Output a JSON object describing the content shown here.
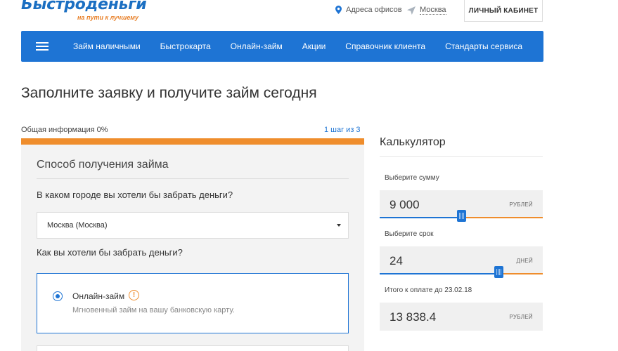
{
  "header": {
    "logo_text": "Быстроденьги",
    "logo_tagline": "на пути к лучшему",
    "offices_link": "Адреса офисов",
    "city_link": "Москва",
    "cabinet_button": "ЛИЧНЫЙ КАБИНЕТ"
  },
  "nav": {
    "items": [
      {
        "label": "Займ наличными"
      },
      {
        "label": "Быстрокарта"
      },
      {
        "label": "Онлайн-займ"
      },
      {
        "label": "Акции"
      },
      {
        "label": "Справочник клиента"
      },
      {
        "label": "Стандарты сервиса"
      }
    ]
  },
  "page": {
    "title": "Заполните заявку и получите займ сегодня"
  },
  "progress": {
    "label": "Общая информация 0%",
    "step": "1 шаг из 3",
    "percent": 0
  },
  "form": {
    "section_title": "Способ получения займа",
    "city_question": "В каком городе вы хотели бы забрать деньги?",
    "city_value": "Москва (Москва)",
    "method_question": "Как вы хотели бы забрать деньги?",
    "option_online": {
      "label": "Онлайн-займ",
      "description": "Мгновенный займ на вашу банковскую карту.",
      "selected": true
    }
  },
  "calculator": {
    "title": "Калькулятор",
    "amount_label": "Выберите сумму",
    "amount_value": "9 000",
    "amount_unit": "РУБЛЕЙ",
    "amount_slider_fraction": 0.5,
    "term_label": "Выберите срок",
    "term_value": "24",
    "term_unit": "ДНЕЙ",
    "term_slider_fraction": 0.73,
    "total_label": "Итого к оплате до 23.02.18",
    "total_value": "13 838.4",
    "total_unit": "РУБЛЕЙ"
  },
  "colors": {
    "brand_blue": "#1e74d4",
    "accent_orange": "#ef8d2c"
  }
}
